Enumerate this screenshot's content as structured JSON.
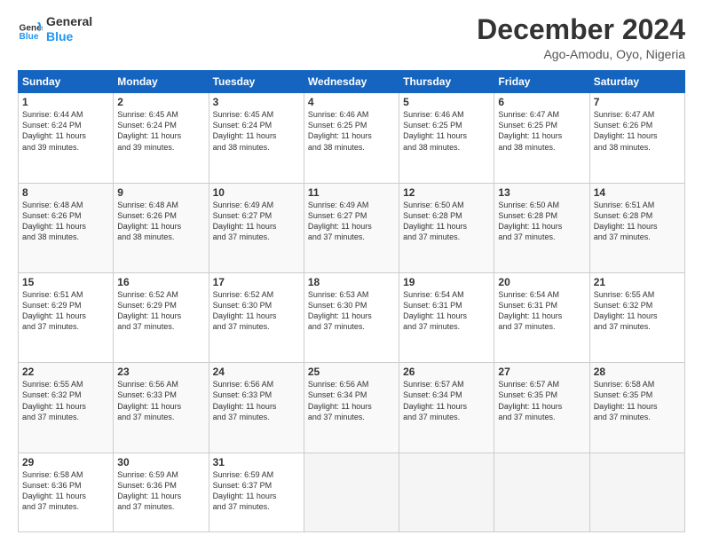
{
  "logo": {
    "line1": "General",
    "line2": "Blue"
  },
  "title": "December 2024",
  "subtitle": "Ago-Amodu, Oyo, Nigeria",
  "header_row": [
    "Sunday",
    "Monday",
    "Tuesday",
    "Wednesday",
    "Thursday",
    "Friday",
    "Saturday"
  ],
  "weeks": [
    [
      {
        "day": "1",
        "sunrise": "6:44 AM",
        "sunset": "6:24 PM",
        "daylight": "11 hours and 39 minutes."
      },
      {
        "day": "2",
        "sunrise": "6:45 AM",
        "sunset": "6:24 PM",
        "daylight": "11 hours and 39 minutes."
      },
      {
        "day": "3",
        "sunrise": "6:45 AM",
        "sunset": "6:24 PM",
        "daylight": "11 hours and 38 minutes."
      },
      {
        "day": "4",
        "sunrise": "6:46 AM",
        "sunset": "6:25 PM",
        "daylight": "11 hours and 38 minutes."
      },
      {
        "day": "5",
        "sunrise": "6:46 AM",
        "sunset": "6:25 PM",
        "daylight": "11 hours and 38 minutes."
      },
      {
        "day": "6",
        "sunrise": "6:47 AM",
        "sunset": "6:25 PM",
        "daylight": "11 hours and 38 minutes."
      },
      {
        "day": "7",
        "sunrise": "6:47 AM",
        "sunset": "6:26 PM",
        "daylight": "11 hours and 38 minutes."
      }
    ],
    [
      {
        "day": "8",
        "sunrise": "6:48 AM",
        "sunset": "6:26 PM",
        "daylight": "11 hours and 38 minutes."
      },
      {
        "day": "9",
        "sunrise": "6:48 AM",
        "sunset": "6:26 PM",
        "daylight": "11 hours and 38 minutes."
      },
      {
        "day": "10",
        "sunrise": "6:49 AM",
        "sunset": "6:27 PM",
        "daylight": "11 hours and 37 minutes."
      },
      {
        "day": "11",
        "sunrise": "6:49 AM",
        "sunset": "6:27 PM",
        "daylight": "11 hours and 37 minutes."
      },
      {
        "day": "12",
        "sunrise": "6:50 AM",
        "sunset": "6:28 PM",
        "daylight": "11 hours and 37 minutes."
      },
      {
        "day": "13",
        "sunrise": "6:50 AM",
        "sunset": "6:28 PM",
        "daylight": "11 hours and 37 minutes."
      },
      {
        "day": "14",
        "sunrise": "6:51 AM",
        "sunset": "6:28 PM",
        "daylight": "11 hours and 37 minutes."
      }
    ],
    [
      {
        "day": "15",
        "sunrise": "6:51 AM",
        "sunset": "6:29 PM",
        "daylight": "11 hours and 37 minutes."
      },
      {
        "day": "16",
        "sunrise": "6:52 AM",
        "sunset": "6:29 PM",
        "daylight": "11 hours and 37 minutes."
      },
      {
        "day": "17",
        "sunrise": "6:52 AM",
        "sunset": "6:30 PM",
        "daylight": "11 hours and 37 minutes."
      },
      {
        "day": "18",
        "sunrise": "6:53 AM",
        "sunset": "6:30 PM",
        "daylight": "11 hours and 37 minutes."
      },
      {
        "day": "19",
        "sunrise": "6:54 AM",
        "sunset": "6:31 PM",
        "daylight": "11 hours and 37 minutes."
      },
      {
        "day": "20",
        "sunrise": "6:54 AM",
        "sunset": "6:31 PM",
        "daylight": "11 hours and 37 minutes."
      },
      {
        "day": "21",
        "sunrise": "6:55 AM",
        "sunset": "6:32 PM",
        "daylight": "11 hours and 37 minutes."
      }
    ],
    [
      {
        "day": "22",
        "sunrise": "6:55 AM",
        "sunset": "6:32 PM",
        "daylight": "11 hours and 37 minutes."
      },
      {
        "day": "23",
        "sunrise": "6:56 AM",
        "sunset": "6:33 PM",
        "daylight": "11 hours and 37 minutes."
      },
      {
        "day": "24",
        "sunrise": "6:56 AM",
        "sunset": "6:33 PM",
        "daylight": "11 hours and 37 minutes."
      },
      {
        "day": "25",
        "sunrise": "6:56 AM",
        "sunset": "6:34 PM",
        "daylight": "11 hours and 37 minutes."
      },
      {
        "day": "26",
        "sunrise": "6:57 AM",
        "sunset": "6:34 PM",
        "daylight": "11 hours and 37 minutes."
      },
      {
        "day": "27",
        "sunrise": "6:57 AM",
        "sunset": "6:35 PM",
        "daylight": "11 hours and 37 minutes."
      },
      {
        "day": "28",
        "sunrise": "6:58 AM",
        "sunset": "6:35 PM",
        "daylight": "11 hours and 37 minutes."
      }
    ],
    [
      {
        "day": "29",
        "sunrise": "6:58 AM",
        "sunset": "6:36 PM",
        "daylight": "11 hours and 37 minutes."
      },
      {
        "day": "30",
        "sunrise": "6:59 AM",
        "sunset": "6:36 PM",
        "daylight": "11 hours and 37 minutes."
      },
      {
        "day": "31",
        "sunrise": "6:59 AM",
        "sunset": "6:37 PM",
        "daylight": "11 hours and 37 minutes."
      },
      null,
      null,
      null,
      null
    ]
  ],
  "labels": {
    "sunrise": "Sunrise: ",
    "sunset": "Sunset: ",
    "daylight": "Daylight: "
  }
}
